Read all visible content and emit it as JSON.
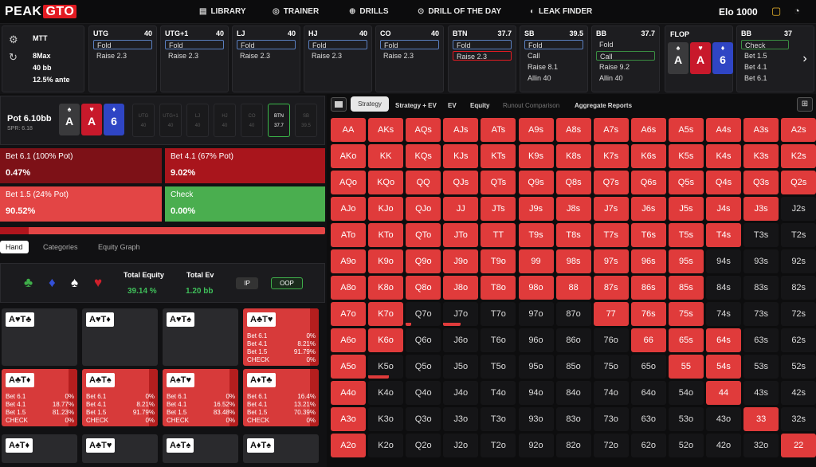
{
  "app": {
    "logo_a": "PEAK",
    "logo_b": "GTO",
    "elo": "Elo 1000"
  },
  "nav": [
    {
      "label": "LIBRARY",
      "icon": "library-icon"
    },
    {
      "label": "TRAINER",
      "icon": "controller-icon"
    },
    {
      "label": "DRILLS",
      "icon": "target-icon"
    },
    {
      "label": "DRILL OF THE DAY",
      "icon": "calendar-icon"
    },
    {
      "label": "LEAK FINDER",
      "icon": "droplet-icon"
    }
  ],
  "game": {
    "type": "MTT",
    "players": "8Max",
    "stack": "40 bb",
    "ante": "12.5% ante"
  },
  "positions": [
    {
      "name": "UTG",
      "stack": "40",
      "actions": [
        "Fold",
        "Raise 2.3"
      ]
    },
    {
      "name": "UTG+1",
      "stack": "40",
      "actions": [
        "Fold",
        "Raise 2.3"
      ]
    },
    {
      "name": "LJ",
      "stack": "40",
      "actions": [
        "Fold",
        "Raise 2.3"
      ]
    },
    {
      "name": "HJ",
      "stack": "40",
      "actions": [
        "Fold",
        "Raise 2.3"
      ]
    },
    {
      "name": "CO",
      "stack": "40",
      "actions": [
        "Fold",
        "Raise 2.3"
      ]
    },
    {
      "name": "BTN",
      "stack": "37.7",
      "actions": [
        "Fold",
        "Raise 2.3"
      ]
    },
    {
      "name": "SB",
      "stack": "39.5",
      "actions": [
        "Fold",
        "Call",
        "Raise 8.1",
        "Allin 40"
      ]
    },
    {
      "name": "BB",
      "stack": "37.7",
      "actions": [
        "Fold",
        "Call",
        "Raise 9.2",
        "Allin 40"
      ]
    }
  ],
  "flop": {
    "label": "FLOP",
    "cards": [
      {
        "rank": "A",
        "suit": "♠",
        "color": "#3a3a3c"
      },
      {
        "rank": "A",
        "suit": "♥",
        "color": "#c8192b"
      },
      {
        "rank": "6",
        "suit": "♦",
        "color": "#2f45c4"
      }
    ]
  },
  "bb_next": {
    "name": "BB",
    "stack": "37",
    "actions": [
      "Check",
      "Bet 1.5",
      "Bet 4.1",
      "Bet 6.1"
    ]
  },
  "pot": {
    "label": "Pot",
    "value": "6.10bb",
    "spr": "SPR: 6.18",
    "cards": [
      {
        "rank": "A",
        "suit": "♠",
        "color": "#3a3a3c"
      },
      {
        "rank": "A",
        "suit": "♥",
        "color": "#c8192b"
      },
      {
        "rank": "6",
        "suit": "♦",
        "color": "#2f45c4"
      }
    ]
  },
  "pos_buttons": [
    {
      "n": "UTG",
      "v": "40"
    },
    {
      "n": "UTG+1",
      "v": "40"
    },
    {
      "n": "LJ",
      "v": "40"
    },
    {
      "n": "HJ",
      "v": "40"
    },
    {
      "n": "CO",
      "v": "40"
    },
    {
      "n": "BTN",
      "v": "37.7"
    },
    {
      "n": "SB",
      "v": "39.5"
    }
  ],
  "actions": [
    {
      "label": "Bet 6.1 (100% Pot)",
      "pct": "0.47%",
      "color": "#7d1117"
    },
    {
      "label": "Bet 4.1 (67% Pot)",
      "pct": "9.02%",
      "color": "#a9151c"
    },
    {
      "label": "Bet 1.5 (24% Pot)",
      "pct": "90.52%",
      "color": "#e34545"
    },
    {
      "label": "Check",
      "pct": "0.00%",
      "color": "#4aae4f"
    }
  ],
  "hand_tabs": [
    "Hand",
    "Categories",
    "Equity Graph"
  ],
  "equity": {
    "total_equity_label": "Total Equity",
    "total_equity": "39.14 %",
    "total_ev_label": "Total Ev",
    "total_ev": "1.20 bb",
    "ip": "IP",
    "oop": "OOP",
    "suits": [
      "♣",
      "♦",
      "♠",
      "♥"
    ]
  },
  "hand_cells": [
    {
      "hand": "A♥T♣",
      "red": false,
      "stats": []
    },
    {
      "hand": "A♥T♦",
      "red": false,
      "stats": []
    },
    {
      "hand": "A♥T♠",
      "red": false,
      "stats": []
    },
    {
      "hand": "A♣T♥",
      "red": true,
      "stats": [
        [
          "Bet 6.1",
          "0%"
        ],
        [
          "Bet 4.1",
          "8.21%"
        ],
        [
          "Bet 1.5",
          "91.79%"
        ],
        [
          "CHECK",
          "0%"
        ]
      ]
    },
    {
      "hand": "A♣T♦",
      "red": true,
      "stats": [
        [
          "Bet 6.1",
          "0%"
        ],
        [
          "Bet 4.1",
          "18.77%"
        ],
        [
          "Bet 1.5",
          "81.23%"
        ],
        [
          "CHECK",
          "0%"
        ]
      ]
    },
    {
      "hand": "A♣T♠",
      "red": true,
      "stats": [
        [
          "Bet 6.1",
          "0%"
        ],
        [
          "Bet 4.1",
          "8.21%"
        ],
        [
          "Bet 1.5",
          "91.79%"
        ],
        [
          "CHECK",
          "0%"
        ]
      ]
    },
    {
      "hand": "A♠T♥",
      "red": true,
      "stats": [
        [
          "Bet 6.1",
          "0%"
        ],
        [
          "Bet 4.1",
          "16.52%"
        ],
        [
          "Bet 1.5",
          "83.48%"
        ],
        [
          "CHECK",
          "0%"
        ]
      ]
    },
    {
      "hand": "A♦T♣",
      "red": true,
      "stats": [
        [
          "Bet 6.1",
          "16.4%"
        ],
        [
          "Bet 4.1",
          "13.21%"
        ],
        [
          "Bet 1.5",
          "70.39%"
        ],
        [
          "CHECK",
          "0%"
        ]
      ]
    },
    {
      "hand": "A♠T♦",
      "red": false,
      "stats": []
    },
    {
      "hand": "A♣T♥",
      "red": false,
      "stats": []
    },
    {
      "hand": "A♠T♠",
      "red": false,
      "stats": []
    },
    {
      "hand": "A♦T♠",
      "red": false,
      "stats": []
    }
  ],
  "right_tabs": [
    "Strategy",
    "Strategy + EV",
    "EV",
    "Equity",
    "Runout Comparison",
    "Aggregate Reports"
  ],
  "grid": {
    "rows": [
      [
        "AA",
        "AKs",
        "AQs",
        "AJs",
        "ATs",
        "A9s",
        "A8s",
        "A7s",
        "A6s",
        "A5s",
        "A4s",
        "A3s",
        "A2s"
      ],
      [
        "AKo",
        "KK",
        "KQs",
        "KJs",
        "KTs",
        "K9s",
        "K8s",
        "K7s",
        "K6s",
        "K5s",
        "K4s",
        "K3s",
        "K2s"
      ],
      [
        "AQo",
        "KQo",
        "QQ",
        "QJs",
        "QTs",
        "Q9s",
        "Q8s",
        "Q7s",
        "Q6s",
        "Q5s",
        "Q4s",
        "Q3s",
        "Q2s"
      ],
      [
        "AJo",
        "KJo",
        "QJo",
        "JJ",
        "JTs",
        "J9s",
        "J8s",
        "J7s",
        "J6s",
        "J5s",
        "J4s",
        "J3s",
        "J2s"
      ],
      [
        "ATo",
        "KTo",
        "QTo",
        "JTo",
        "TT",
        "T9s",
        "T8s",
        "T7s",
        "T6s",
        "T5s",
        "T4s",
        "T3s",
        "T2s"
      ],
      [
        "A9o",
        "K9o",
        "Q9o",
        "J9o",
        "T9o",
        "99",
        "98s",
        "97s",
        "96s",
        "95s",
        "94s",
        "93s",
        "92s"
      ],
      [
        "A8o",
        "K8o",
        "Q8o",
        "J8o",
        "T8o",
        "98o",
        "88",
        "87s",
        "86s",
        "85s",
        "84s",
        "83s",
        "82s"
      ],
      [
        "A7o",
        "K7o",
        "Q7o",
        "J7o",
        "T7o",
        "97o",
        "87o",
        "77",
        "76s",
        "75s",
        "74s",
        "73s",
        "72s"
      ],
      [
        "A6o",
        "K6o",
        "Q6o",
        "J6o",
        "T6o",
        "96o",
        "86o",
        "76o",
        "66",
        "65s",
        "64s",
        "63s",
        "62s"
      ],
      [
        "A5o",
        "K5o",
        "Q5o",
        "J5o",
        "T5o",
        "95o",
        "85o",
        "75o",
        "65o",
        "55",
        "54s",
        "53s",
        "52s"
      ],
      [
        "A4o",
        "K4o",
        "Q4o",
        "J4o",
        "T4o",
        "94o",
        "84o",
        "74o",
        "64o",
        "54o",
        "44",
        "43s",
        "42s"
      ],
      [
        "A3o",
        "K3o",
        "Q3o",
        "J3o",
        "T3o",
        "93o",
        "83o",
        "73o",
        "63o",
        "53o",
        "43o",
        "33",
        "32s"
      ],
      [
        "A2o",
        "K2o",
        "Q2o",
        "J2o",
        "T2o",
        "92o",
        "82o",
        "72o",
        "62o",
        "52o",
        "42o",
        "32o",
        "22"
      ]
    ],
    "fill": [
      [
        1,
        1,
        1,
        1,
        1,
        1,
        1,
        1,
        1,
        1,
        1,
        1,
        1
      ],
      [
        1,
        1,
        1,
        1,
        1,
        1,
        1,
        1,
        1,
        1,
        1,
        1,
        1
      ],
      [
        1,
        1,
        1,
        1,
        1,
        1,
        1,
        1,
        1,
        1,
        1,
        1,
        1
      ],
      [
        1,
        1,
        1,
        1,
        1,
        1,
        1,
        1,
        1,
        1,
        1,
        1,
        0
      ],
      [
        1,
        1,
        1,
        1,
        1,
        1,
        1,
        1,
        1,
        1,
        1,
        0,
        0
      ],
      [
        1,
        1,
        1,
        1,
        1,
        1,
        1,
        1,
        1,
        1,
        0,
        0,
        0
      ],
      [
        1,
        1,
        1,
        1,
        1,
        1,
        1,
        1,
        1,
        1,
        0,
        0,
        0
      ],
      [
        1,
        1,
        0.15,
        0.5,
        0,
        0,
        0,
        1,
        1,
        1,
        0,
        0,
        0
      ],
      [
        1,
        1,
        0,
        0,
        0,
        0,
        0,
        0,
        1,
        1,
        1,
        0,
        0
      ],
      [
        1,
        0.6,
        0,
        0,
        0,
        0,
        0,
        0,
        0,
        1,
        1,
        0,
        0
      ],
      [
        1,
        0,
        0,
        0,
        0,
        0,
        0,
        0,
        0,
        0,
        1,
        0,
        0
      ],
      [
        1,
        0,
        0,
        0,
        0,
        0,
        0,
        0,
        0,
        0,
        0,
        1,
        0
      ],
      [
        1,
        0,
        0,
        0,
        0,
        0,
        0,
        0,
        0,
        0,
        0,
        0,
        1
      ]
    ]
  }
}
